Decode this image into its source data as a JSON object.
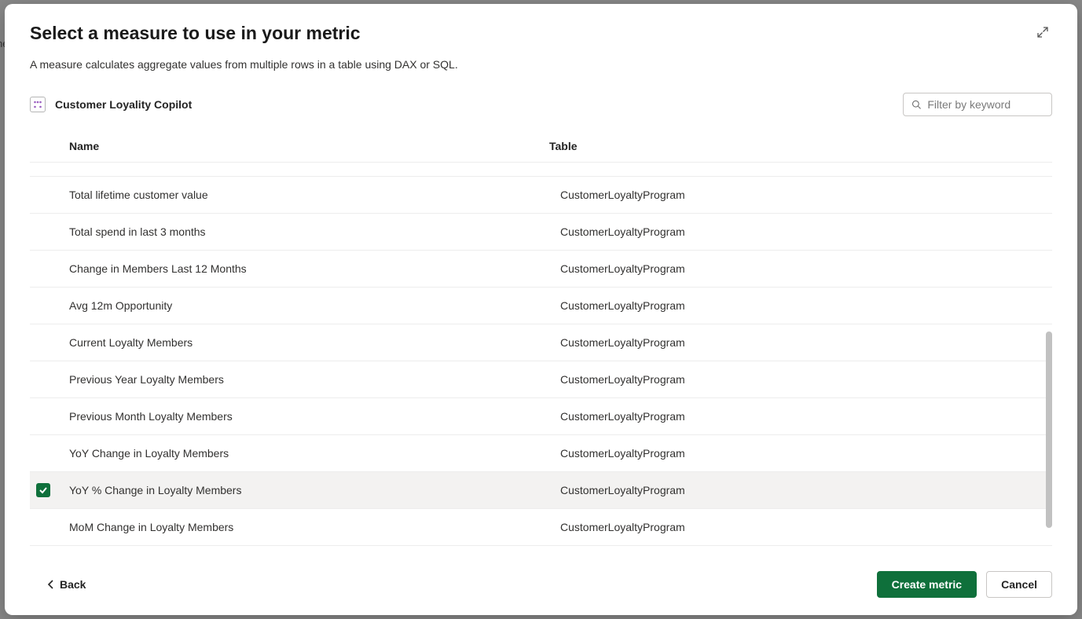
{
  "dialog": {
    "title": "Select a measure to use in your metric",
    "subtitle": "A measure calculates aggregate values from multiple rows in a table using DAX or SQL.",
    "model_name": "Customer Loyality Copilot"
  },
  "search": {
    "placeholder": "Filter by keyword"
  },
  "columns": {
    "name": "Name",
    "table": "Table"
  },
  "rows": [
    {
      "name": "",
      "table": "",
      "selected": false,
      "partial_top": true
    },
    {
      "name": "Total lifetime customer value",
      "table": "CustomerLoyaltyProgram",
      "selected": false
    },
    {
      "name": "Total spend in last 3 months",
      "table": "CustomerLoyaltyProgram",
      "selected": false
    },
    {
      "name": "Change in Members Last 12 Months",
      "table": "CustomerLoyaltyProgram",
      "selected": false
    },
    {
      "name": "Avg 12m Opportunity",
      "table": "CustomerLoyaltyProgram",
      "selected": false
    },
    {
      "name": "Current Loyalty Members",
      "table": "CustomerLoyaltyProgram",
      "selected": false
    },
    {
      "name": "Previous Year Loyalty Members",
      "table": "CustomerLoyaltyProgram",
      "selected": false
    },
    {
      "name": "Previous Month Loyalty Members",
      "table": "CustomerLoyaltyProgram",
      "selected": false
    },
    {
      "name": "YoY Change in Loyalty Members",
      "table": "CustomerLoyaltyProgram",
      "selected": false
    },
    {
      "name": "YoY % Change in Loyalty Members",
      "table": "CustomerLoyaltyProgram",
      "selected": true
    },
    {
      "name": "MoM Change in Loyalty Members",
      "table": "CustomerLoyaltyProgram",
      "selected": false
    }
  ],
  "footer": {
    "back": "Back",
    "create": "Create metric",
    "cancel": "Cancel"
  }
}
